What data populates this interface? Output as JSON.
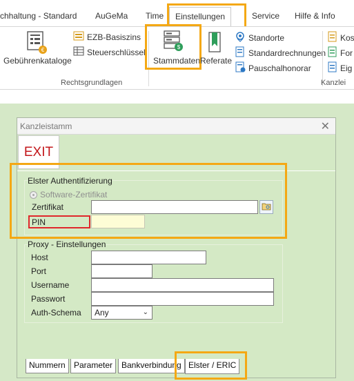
{
  "ribbon": {
    "tabs": [
      {
        "label": "chhaltung - Standard"
      },
      {
        "label": "AuGeMa"
      },
      {
        "label": "Time"
      },
      {
        "label": "Einstellungen"
      },
      {
        "label": "Service"
      },
      {
        "label": "Hilfe & Info"
      }
    ],
    "buttons": {
      "gebuehren": "Gebührenkataloge",
      "ezb": "EZB-Basiszins",
      "steuer": "Steuerschlüssel",
      "stammdaten": "Stammdaten",
      "referate": "Referate",
      "standorte": "Standorte",
      "standardrechnungen": "Standardrechnungen",
      "pauschalhonorar": "Pauschalhonorar",
      "kos": "Kos",
      "for": "For",
      "eig": "Eig"
    },
    "groups": {
      "rechtsgrundlagen": "Rechtsgrundlagen",
      "kanzlei": "Kanzlei"
    }
  },
  "dialog": {
    "title": "Kanzleistamm",
    "close": "✕",
    "exit_label": "EXIT",
    "elster": {
      "legend": "Elster Authentifizierung",
      "radio_label": "Software-Zertifikat",
      "zertifikat_label": "Zertifikat",
      "zertifikat_value": "",
      "pin_label": "PIN",
      "pin_value": ""
    },
    "proxy": {
      "legend": "Proxy - Einstellungen",
      "host_label": "Host",
      "port_label": "Port",
      "username_label": "Username",
      "passwort_label": "Passwort",
      "auth_label": "Auth-Schema",
      "auth_value": "Any"
    },
    "bottom_tabs": [
      {
        "label": "Nummern"
      },
      {
        "label": "Parameter"
      },
      {
        "label": "Bankverbindung"
      },
      {
        "label": "Elster / ERIC"
      }
    ]
  },
  "colors": {
    "highlight": "#f4a814",
    "exit_red": "#c3171b",
    "pin_outline": "#e0262b",
    "dialog_bg": "#d4e9c5"
  }
}
